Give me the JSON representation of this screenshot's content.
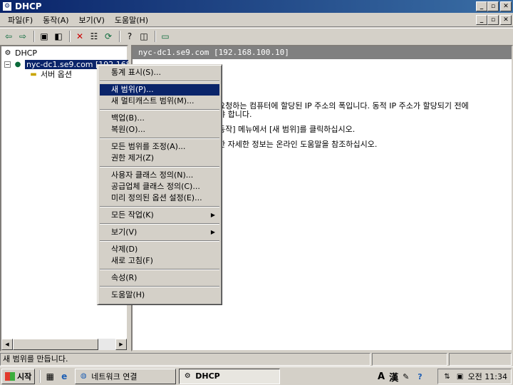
{
  "window": {
    "title": "DHCP"
  },
  "menubar": [
    "파일(F)",
    "동작(A)",
    "보기(V)",
    "도움말(H)"
  ],
  "tree": {
    "root": "DHCP",
    "server": "nyc-dc1.se9.com [192.168",
    "child": "서버 옵션"
  },
  "right": {
    "header": "nyc-dc1.se9.com [192.168.100.10]",
    "lines": [
      "요청하는 컴퓨터에 할당된 IP 주소의 폭입니다. 동적 IP 주소가 할당되기 전에",
      "야 합니다.",
      "동작] 메뉴에서 [새 범위]를 클릭하십시오.",
      "한 자세한 정보는 온라인 도움말을 참조하십시오."
    ]
  },
  "context_menu": [
    {
      "label": "통계 표시(S)...",
      "highlighted": false,
      "submenu": false
    },
    {
      "sep": true
    },
    {
      "label": "새 범위(P)...",
      "highlighted": true,
      "submenu": false
    },
    {
      "label": "새 멀티캐스트 범위(M)...",
      "highlighted": false,
      "submenu": false
    },
    {
      "sep": true
    },
    {
      "label": "백업(B)...",
      "highlighted": false,
      "submenu": false
    },
    {
      "label": "복원(O)...",
      "highlighted": false,
      "submenu": false
    },
    {
      "sep": true
    },
    {
      "label": "모든 범위를 조정(A)...",
      "highlighted": false,
      "submenu": false
    },
    {
      "label": "권한 제거(Z)",
      "highlighted": false,
      "submenu": false
    },
    {
      "sep": true
    },
    {
      "label": "사용자 클래스 정의(N)...",
      "highlighted": false,
      "submenu": false
    },
    {
      "label": "공급업체 클래스 정의(C)...",
      "highlighted": false,
      "submenu": false
    },
    {
      "label": "미리 정의된 옵션 설정(E)...",
      "highlighted": false,
      "submenu": false
    },
    {
      "sep": true
    },
    {
      "label": "모든 작업(K)",
      "highlighted": false,
      "submenu": true
    },
    {
      "sep": true
    },
    {
      "label": "보기(V)",
      "highlighted": false,
      "submenu": true
    },
    {
      "sep": true
    },
    {
      "label": "삭제(D)",
      "highlighted": false,
      "submenu": false
    },
    {
      "label": "새로 고침(F)",
      "highlighted": false,
      "submenu": false
    },
    {
      "sep": true
    },
    {
      "label": "속성(R)",
      "highlighted": false,
      "submenu": false
    },
    {
      "sep": true
    },
    {
      "label": "도움말(H)",
      "highlighted": false,
      "submenu": false
    }
  ],
  "status": {
    "text": "새 범위를 만듭니다."
  },
  "taskbar": {
    "start": "시작",
    "tasks": [
      "네트워크 연결",
      "DHCP"
    ],
    "lang_a": "A",
    "lang_han": "漢",
    "clock": "오전 11:34"
  }
}
